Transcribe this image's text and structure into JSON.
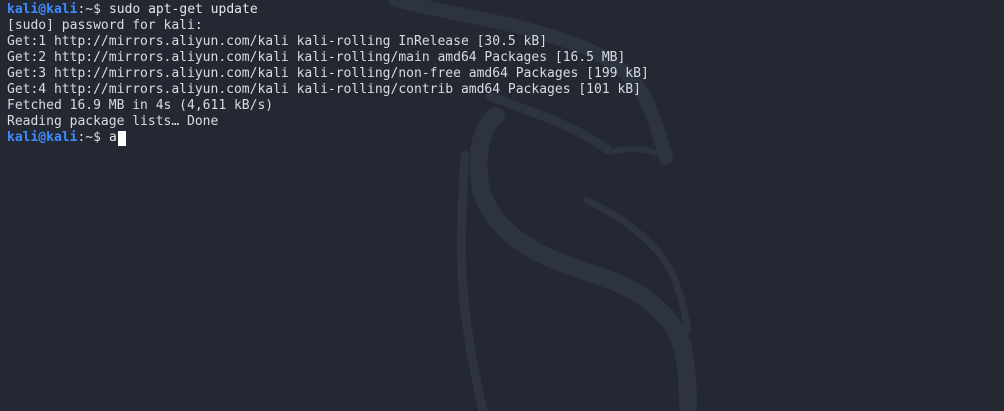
{
  "prompt": {
    "user_host": "kali@kali",
    "path": ":~",
    "symbol": "$"
  },
  "lines": {
    "command_1": "sudo apt-get update",
    "out_1": "[sudo] password for kali:",
    "out_2": "Get:1 http://mirrors.aliyun.com/kali kali-rolling InRelease [30.5 kB]",
    "out_3": "Get:2 http://mirrors.aliyun.com/kali kali-rolling/main amd64 Packages [16.5 MB]",
    "out_4": "Get:3 http://mirrors.aliyun.com/kali kali-rolling/non-free amd64 Packages [199 kB]",
    "out_5": "Get:4 http://mirrors.aliyun.com/kali kali-rolling/contrib amd64 Packages [101 kB]",
    "out_6": "Fetched 16.9 MB in 4s (4,611 kB/s)",
    "out_7": "Reading package lists… Done",
    "command_2": "a"
  },
  "colors": {
    "background": "#242832",
    "prompt_user": "#3f8cff",
    "text": "#d7dbe2",
    "cursor": "#ffffff"
  },
  "icons": {
    "watermark": "kali-dragon-watermark-icon"
  }
}
